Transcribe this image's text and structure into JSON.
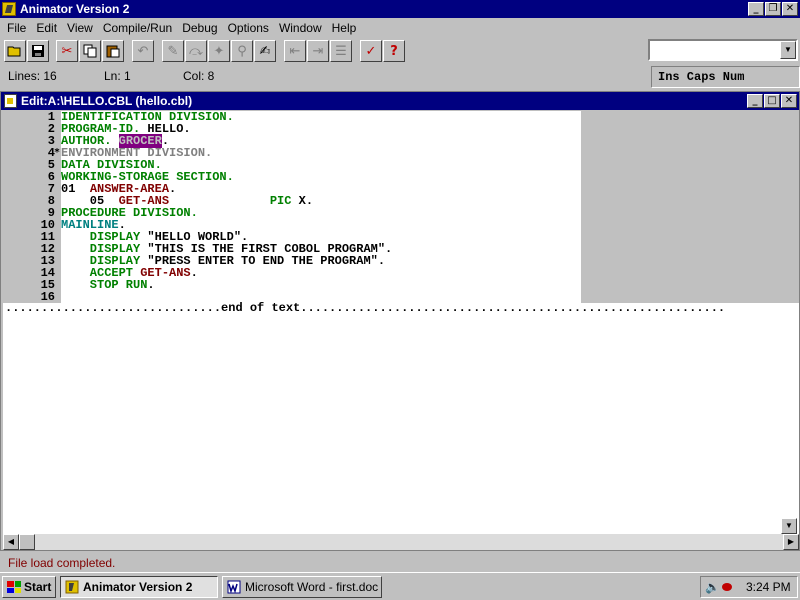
{
  "app": {
    "title": "Animator Version 2",
    "window_buttons": [
      "_",
      "❐",
      "✕"
    ]
  },
  "menu": [
    "File",
    "Edit",
    "View",
    "Compile/Run",
    "Debug",
    "Options",
    "Window",
    "Help"
  ],
  "toolbar": {
    "icons": [
      "open-folder-icon",
      "save-icon",
      "cut-icon",
      "copy-icon",
      "paste-icon",
      "undo-icon",
      "step-icon",
      "step-over-icon",
      "run-icon",
      "zoom-icon",
      "go-icon",
      "break-in-icon",
      "break-out-icon",
      "break-list-icon",
      "check-icon",
      "help-icon"
    ],
    "combo_value": ""
  },
  "status": {
    "lines": "Lines: 16",
    "ln": "Ln: 1",
    "col": "Col: 8",
    "modes": "Ins Caps Num"
  },
  "editor": {
    "title": "Edit:A:\\HELLO.CBL (hello.cbl)",
    "window_buttons": [
      "_",
      "□",
      "✕"
    ],
    "lines": [
      {
        "n": "1",
        "mark": "",
        "segs": [
          [
            "g",
            "IDENTIFICATION DIVISION."
          ]
        ]
      },
      {
        "n": "2",
        "mark": "",
        "segs": [
          [
            "g",
            "PROGRAM-ID."
          ],
          [
            "k",
            " HELLO."
          ]
        ]
      },
      {
        "n": "3",
        "mark": "",
        "segs": [
          [
            "g",
            "AUTHOR."
          ],
          [
            "k",
            " "
          ],
          [
            "hl",
            "GROCER"
          ],
          [
            "k",
            "."
          ]
        ]
      },
      {
        "n": "4",
        "mark": "*",
        "segs": [
          [
            "gr",
            "ENVIRONMENT DIVISION."
          ]
        ]
      },
      {
        "n": "5",
        "mark": "",
        "segs": [
          [
            "g",
            "DATA DIVISION."
          ]
        ]
      },
      {
        "n": "6",
        "mark": "",
        "segs": [
          [
            "g",
            "WORKING-STORAGE SECTION."
          ]
        ]
      },
      {
        "n": "7",
        "mark": "",
        "segs": [
          [
            "k",
            "01  "
          ],
          [
            "r",
            "ANSWER-AREA"
          ],
          [
            "k",
            "."
          ]
        ]
      },
      {
        "n": "8",
        "mark": "",
        "segs": [
          [
            "k",
            "    05  "
          ],
          [
            "r",
            "GET-ANS"
          ],
          [
            "k",
            "              "
          ],
          [
            "g",
            "PIC"
          ],
          [
            "k",
            " X."
          ]
        ]
      },
      {
        "n": "9",
        "mark": "",
        "segs": [
          [
            "g",
            "PROCEDURE DIVISION."
          ]
        ]
      },
      {
        "n": "10",
        "mark": "",
        "segs": [
          [
            "t",
            "MAINLINE"
          ],
          [
            "k",
            "."
          ]
        ]
      },
      {
        "n": "11",
        "mark": "",
        "segs": [
          [
            "g",
            "    DISPLAY"
          ],
          [
            "k",
            " \"HELLO WORLD\"."
          ]
        ]
      },
      {
        "n": "12",
        "mark": "",
        "segs": [
          [
            "g",
            "    DISPLAY"
          ],
          [
            "k",
            " \"THIS IS THE FIRST COBOL PROGRAM\"."
          ]
        ]
      },
      {
        "n": "13",
        "mark": "",
        "segs": [
          [
            "g",
            "    DISPLAY"
          ],
          [
            "k",
            " \"PRESS ENTER TO END THE PROGRAM\"."
          ]
        ]
      },
      {
        "n": "14",
        "mark": "",
        "segs": [
          [
            "g",
            "    ACCEPT"
          ],
          [
            "k",
            " "
          ],
          [
            "r",
            "GET-ANS"
          ],
          [
            "k",
            "."
          ]
        ]
      },
      {
        "n": "15",
        "mark": "",
        "segs": [
          [
            "g",
            "    STOP RUN"
          ],
          [
            "k",
            "."
          ]
        ]
      },
      {
        "n": "16",
        "mark": "",
        "segs": []
      }
    ],
    "end_of_text": "..............................end of text..........................................................."
  },
  "message": "File load completed.",
  "taskbar": {
    "start": "Start",
    "tasks": [
      "Animator Version 2",
      "Microsoft Word - first.doc"
    ],
    "clock": "3:24 PM"
  },
  "colors": {
    "title_bar": "#000080",
    "keyword_green": "#008000",
    "data_name_red": "#800000",
    "paragraph_teal": "#008080",
    "highlight_purple": "#800080",
    "message_red": "#800000"
  }
}
